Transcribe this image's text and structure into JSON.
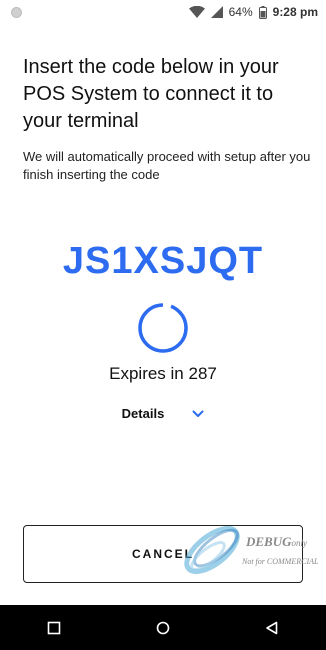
{
  "status_bar": {
    "battery": "64%",
    "time": "9:28 pm"
  },
  "main": {
    "title": "Insert the code below in your POS System to connect it to your terminal",
    "subtitle": "We will automatically proceed with setup after you finish inserting the code",
    "code": "JS1XSJQT",
    "expires": "Expires in 287",
    "details_label": "Details",
    "cancel_label": "CANCEL"
  },
  "watermark": {
    "debug": "DEBUG",
    "debug_suffix": "only",
    "not_commercial": "Not for COMMERCIAL"
  },
  "colors": {
    "accent": "#2d6cf0",
    "nav_background": "#000000"
  },
  "icons": {
    "status_left": "notification-dot-icon",
    "wifi": "wifi-icon",
    "signal": "signal-icon",
    "battery": "battery-icon",
    "spinner": "loading-spinner-icon",
    "details": "chevron-down-icon",
    "nav_recents": "recents-square-icon",
    "nav_home": "home-circle-icon",
    "nav_back": "back-triangle-icon"
  }
}
